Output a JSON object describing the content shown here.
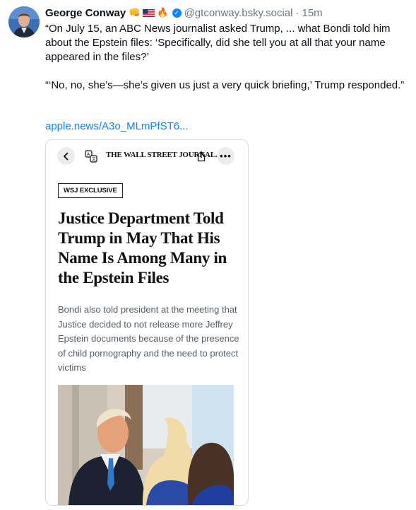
{
  "post": {
    "author": {
      "name": "George Conway",
      "emojis": [
        "👊",
        "🇺🇸",
        "🔥"
      ],
      "handle": "@gtconway.bsky.social",
      "separator": "·",
      "time": "15m"
    },
    "text": {
      "paragraph1": "“On July 15, an ABC News journalist asked Trump, ... what Bondi told him about the Epstein files: ‘Specifically, did she tell you at all that your name appeared in the files?’",
      "paragraph2": "“‘No, no, she’s—she’s given us just a very quick briefing,’ Trump responded.”"
    },
    "link": "apple.news/A3o_MLmPfST6..."
  },
  "embed": {
    "toolbar": {
      "masthead": "THE WALL STREET JOURNAL."
    },
    "badge": "WSJ EXCLUSIVE",
    "headline": "Justice Department Told Trump in May That His Name Is Among Many in the Epstein Files",
    "dek": "Bondi also told president at the meeting that Justice decided to not release more Jeffrey Epstein documents because of the presence of child pornography and the need to protect victims"
  },
  "icons": {
    "verified": "verified-badge-icon",
    "back": "chevron-left-icon",
    "translate": "translate-icon",
    "share": "share-icon",
    "more": "more-options-icon"
  },
  "colors": {
    "link": "#1083fe",
    "muted": "#66788a",
    "verified": "#1083fe"
  }
}
